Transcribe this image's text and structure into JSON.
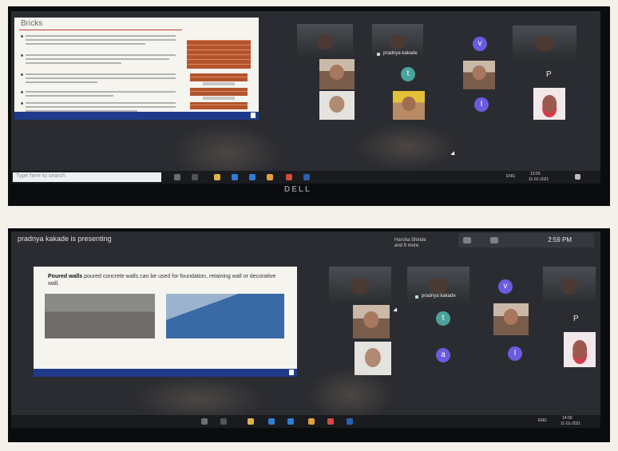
{
  "photo1": {
    "slide": {
      "title": "Bricks",
      "image_captions": [
        "Ordinary Brick",
        "Hollow Brick",
        "Paving Brick"
      ]
    },
    "participants": {
      "letters": {
        "v": "v",
        "t": "t",
        "i": "I",
        "p": "P"
      },
      "pinned_name": "pradnya kakade"
    },
    "taskbar": {
      "search_placeholder": "Type here to search",
      "language": "ENG",
      "time": "13:59",
      "date": "11-01-2021"
    },
    "bezel_logo": "DELL"
  },
  "photo2": {
    "banner": "pradnya kakade is presenting",
    "presenter_chip": [
      "Harsha Shinde",
      "and 9 more"
    ],
    "clock": "2:59 PM",
    "slide": {
      "bullet_bold": "Poured walls",
      "bullet_rest": " poured concrete walls can be used for foundation, retaining wall or decorative wall."
    },
    "participants": {
      "letters": {
        "v": "v",
        "t": "t",
        "a": "a",
        "i": "I",
        "p": "P"
      },
      "pinned_name": "pradnya kakade"
    },
    "taskbar": {
      "language": "ENG",
      "time": "14:00",
      "date": "11-01-2021"
    }
  },
  "colors": {
    "avatar_purple": "#6a5ce0",
    "avatar_teal": "#4aa39c",
    "slide_footer": "#1f3a8a",
    "title_rule": "#c0392b"
  }
}
